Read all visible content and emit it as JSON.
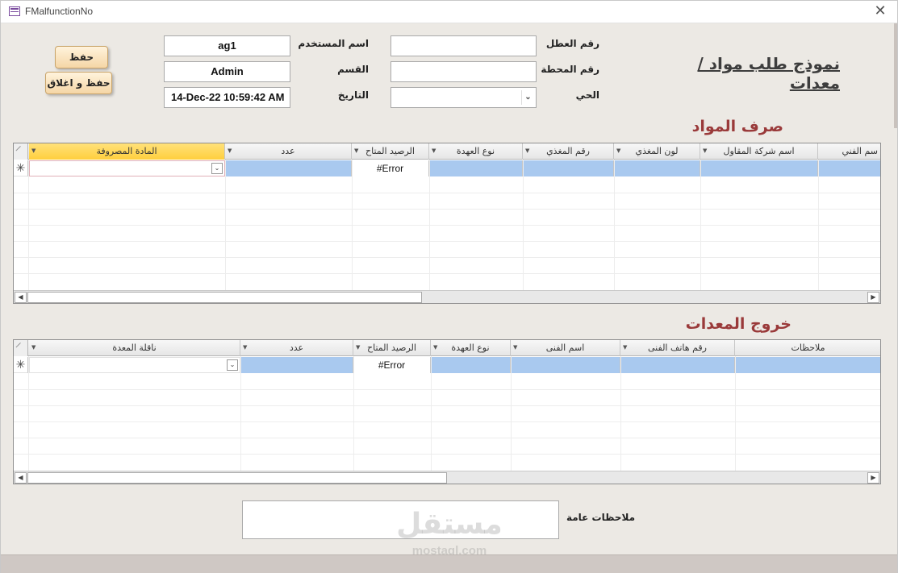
{
  "window": {
    "title": "FMalfunctionNo",
    "close_glyph": "✕"
  },
  "form": {
    "title": "نموذج طلب مواد / معدات",
    "fields": {
      "malfunction_no_label": "رقم العطل",
      "malfunction_no_value": "",
      "station_no_label": "رقم المحطة",
      "station_no_value": "",
      "district_label": "الحي",
      "district_value": "",
      "username_label": "اسم المستخدم",
      "username_value": "ag1",
      "department_label": "القسم",
      "department_value": "Admin",
      "date_label": "التاريخ",
      "date_value": "14-Dec-22 10:59:42 AM"
    },
    "buttons": {
      "save": "حفظ",
      "save_close": "حفظ و اغلاق"
    }
  },
  "materials": {
    "title": "صرف المواد",
    "columns": [
      "المادة المصروفة",
      "عدد",
      "الرصيد المتاح",
      "نوع العهدة",
      "رقم المغذي",
      "لون المغذي",
      "اسم شركة المقاول",
      "سم الفني"
    ],
    "new_row": {
      "selector": "✳",
      "available_balance": "#Error"
    }
  },
  "equipment": {
    "title": "خروج المعدات",
    "columns": [
      "ناقلة المعدة",
      "عدد",
      "الرصيد المتاح",
      "نوع العهدة",
      "اسم الفنى",
      "رقم هاتف الفنى",
      "ملاحظات"
    ],
    "new_row": {
      "selector": "✳",
      "available_balance": "#Error"
    }
  },
  "general_notes": {
    "label": "ملاحظات عامة",
    "value": ""
  },
  "watermark": {
    "main": "مستقل",
    "sub": "mostaql.com"
  },
  "icons": {
    "app": "access-form-icon",
    "dropdown": "chevron-down-icon",
    "header_sort": "triangle-down-icon",
    "scroll_left": "triangle-left-icon",
    "scroll_right": "triangle-right-icon"
  }
}
